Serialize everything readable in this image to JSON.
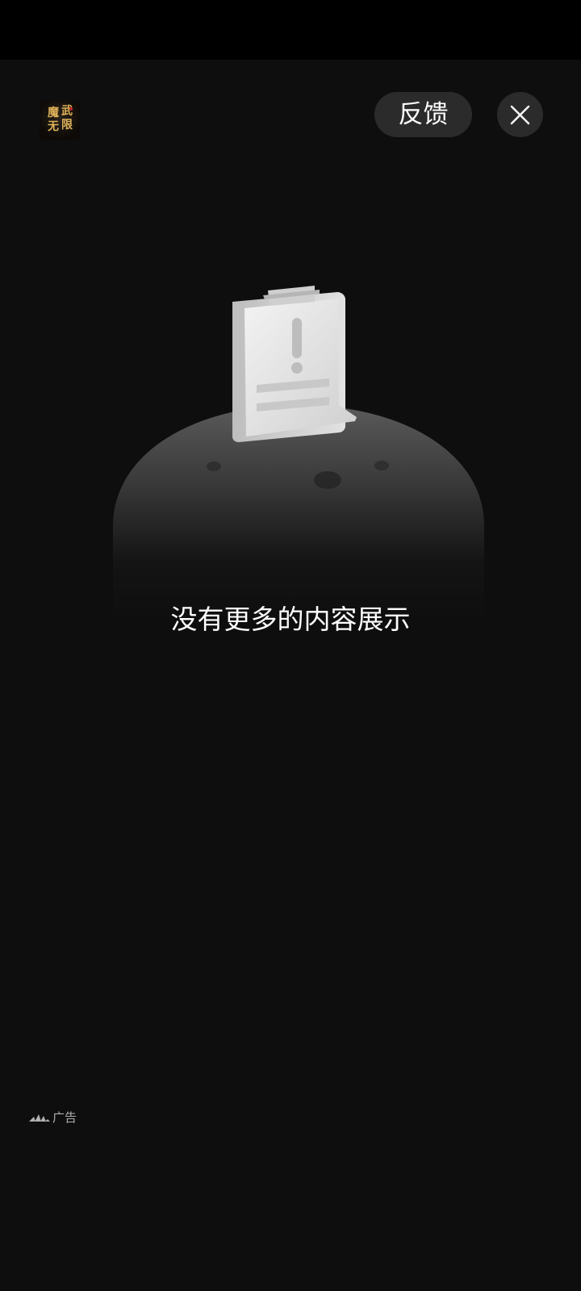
{
  "app": {
    "icon_name": "app-logo-icon",
    "icon_text": [
      "魔",
      "武",
      "无",
      "限"
    ]
  },
  "header": {
    "feedback_label": "反馈",
    "close_icon": "close-icon"
  },
  "main": {
    "empty_message": "没有更多的内容展示",
    "illustration_icon": "empty-document-warning-illustration"
  },
  "footer": {
    "ad_logo_icon": "ad-network-logo-icon",
    "ad_label": "广告"
  },
  "colors": {
    "background": "#0e0e0e",
    "status_bar": "#000000",
    "button_bg": "#2b2b2b",
    "text_primary": "#ffffff",
    "text_secondary": "#b0b0b0"
  }
}
